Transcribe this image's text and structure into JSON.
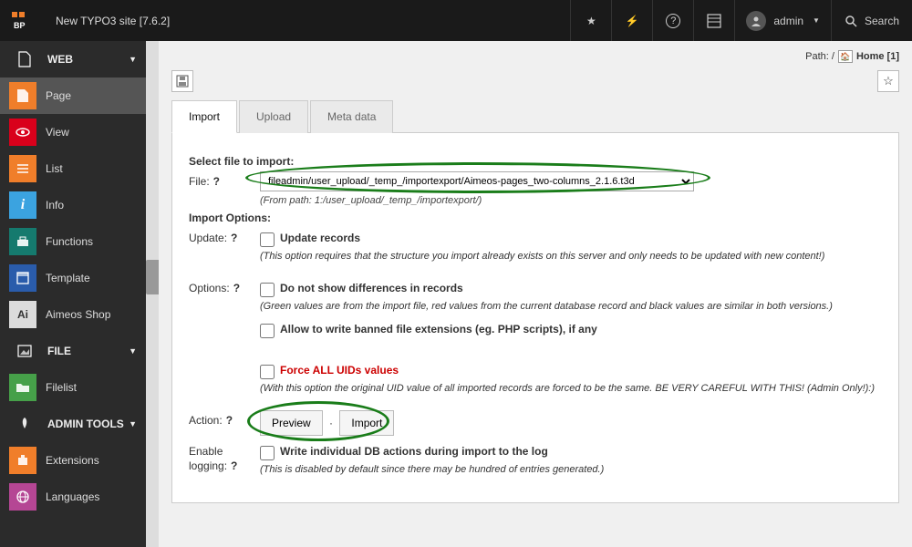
{
  "topbar": {
    "site_title": "New TYPO3 site [7.6.2]",
    "user_label": "admin",
    "search_placeholder": "Search"
  },
  "sidebar": {
    "groups": [
      {
        "key": "web",
        "label": "WEB",
        "items": [
          {
            "key": "page",
            "label": "Page",
            "icon": "page",
            "active": true
          },
          {
            "key": "view",
            "label": "View",
            "icon": "view"
          },
          {
            "key": "list",
            "label": "List",
            "icon": "list"
          },
          {
            "key": "info",
            "label": "Info",
            "icon": "info"
          },
          {
            "key": "functions",
            "label": "Functions",
            "icon": "func"
          },
          {
            "key": "template",
            "label": "Template",
            "icon": "tmpl"
          },
          {
            "key": "aimeos",
            "label": "Aimeos Shop",
            "icon": "aimeos"
          }
        ]
      },
      {
        "key": "file",
        "label": "FILE",
        "items": [
          {
            "key": "filelist",
            "label": "Filelist",
            "icon": "filelist"
          }
        ]
      },
      {
        "key": "admin",
        "label": "ADMIN TOOLS",
        "items": [
          {
            "key": "extensions",
            "label": "Extensions",
            "icon": "ext"
          },
          {
            "key": "languages",
            "label": "Languages",
            "icon": "lang"
          }
        ]
      }
    ]
  },
  "path": {
    "prefix": "Path: /",
    "home_label": "Home [1]"
  },
  "tabs": {
    "import": "Import",
    "upload": "Upload",
    "metadata": "Meta data"
  },
  "import": {
    "select_title": "Select file to import:",
    "file_label": "File:",
    "file_value": "fileadmin/user_upload/_temp_/importexport/Aimeos-pages_two-columns_2.1.6.t3d",
    "from_path": "(From path: 1:/user_upload/_temp_/importexport/)",
    "options_title": "Import Options:",
    "update_label": "Update:",
    "update_check": "Update records",
    "update_desc": "(This option requires that the structure you import already exists on this server and only needs to be updated with new content!)",
    "options_label": "Options:",
    "nodiff_check": "Do not show differences in records",
    "nodiff_desc": "(Green values are from the import file, red values from the current database record and black values are similar in both versions.)",
    "banned_check": "Allow to write banned file extensions (eg. PHP scripts), if any",
    "force_check": "Force ALL UIDs values",
    "force_desc": "(With this option the original UID value of all imported records are forced to be the same. BE VERY CAREFUL WITH THIS! (Admin Only!):)",
    "action_label": "Action:",
    "preview_btn": "Preview",
    "import_btn": "Import",
    "logging_label": "Enable logging:",
    "logging_check": "Write individual DB actions during import to the log",
    "logging_desc": "(This is disabled by default since there may be hundred of entries generated.)"
  }
}
